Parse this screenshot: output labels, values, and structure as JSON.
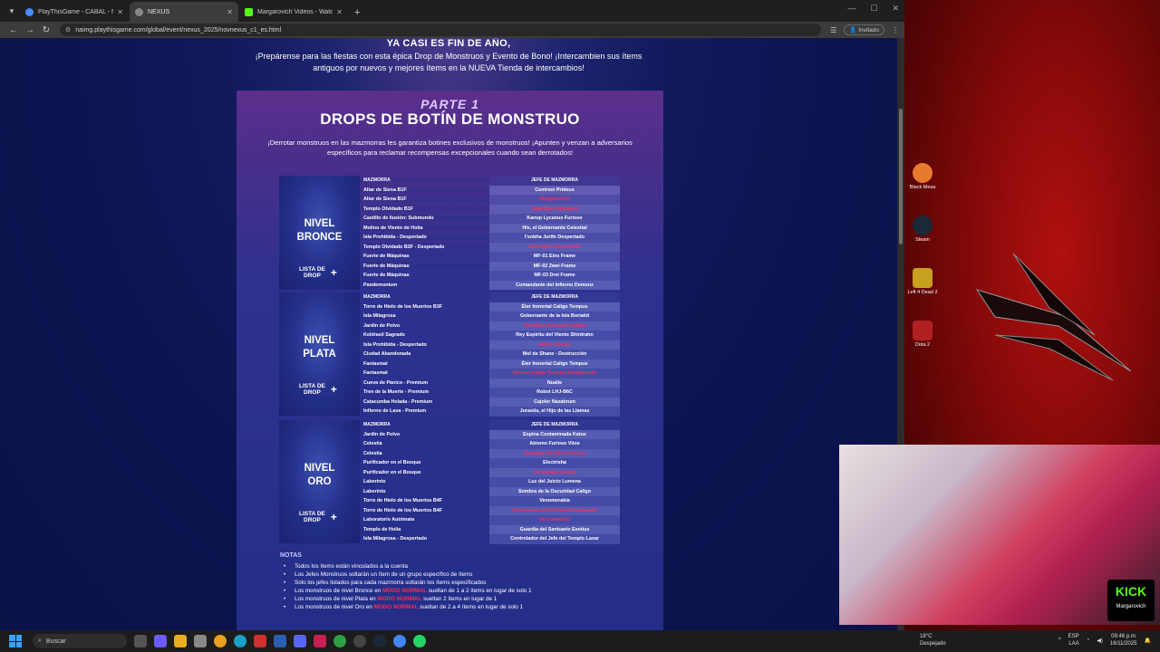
{
  "browser": {
    "tabs": [
      {
        "label": "PlayThisGame - CABAL - Notice",
        "active": false,
        "color": "#4a8cff"
      },
      {
        "label": "NEXUS",
        "active": true,
        "color": "#888888"
      },
      {
        "label": "Margarovich Videos - Watch C",
        "active": false,
        "color": "#53fc18"
      }
    ],
    "url": "naimg.playthisgame.com/global/event/nexus_2025/novnexus_c1_es.html",
    "guest_label": "Invitado"
  },
  "page": {
    "intro_title": "YA CASI ES FIN DE AÑO,",
    "intro_text": "¡Prepárense para las fiestas con esta épica Drop de Monstruos y Evento de Bono! ¡Intercambien sus ítems antiguos por nuevos y mejores ítems en la NUEVA Tienda de intercambios!",
    "part_label": "PARTE 1",
    "section_title": "DROPS DE BOTÍN DE MONSTRUO",
    "section_desc": "¡Derrotar monstruos en las mazmorras les garantiza botines exclusivos de monstruos! ¡Apunten y venzan a adversarios específicos para reclamar recompensas excepcionales cuando sean derrotados!",
    "col_dungeon": "MAZMORRA",
    "col_boss": "JEFE DE MAZMORRA",
    "drop_label_1": "LISTA DE",
    "drop_label_2": "DROP",
    "tiers": [
      {
        "name_1": "NIVEL",
        "name_2": "BRONCE",
        "rows": [
          {
            "dungeon": "Altar de Siena B1F",
            "boss": "Centrion Prideus",
            "hidden": false
          },
          {
            "dungeon": "Altar de Siena B1F",
            "boss": "Margarovich",
            "hidden": true
          },
          {
            "dungeon": "Templo Olvidado B1F",
            "boss": "Guardián Flamígero",
            "hidden": true
          },
          {
            "dungeon": "Castillo de Ilusión: Submundo",
            "boss": "Kanop Lycanus Furioso",
            "hidden": false
          },
          {
            "dungeon": "Molino de Viento de Holia",
            "boss": "Hix, el Gobernante Celestial",
            "hidden": false
          },
          {
            "dungeon": "Isla Prohibida - Despertado",
            "boss": "I'sobha Jurife Despertado",
            "hidden": false
          },
          {
            "dungeon": "Templo Olvidado B2F - Despertado",
            "boss": "Gran Ignis Despertado",
            "hidden": true
          },
          {
            "dungeon": "Fuerte de Máquinas",
            "boss": "MF-01 Eins Frame",
            "hidden": false
          },
          {
            "dungeon": "Fuerte de Máquinas",
            "boss": "MF-02 Zwei Frame",
            "hidden": false
          },
          {
            "dungeon": "Fuerte de Máquinas",
            "boss": "MF-03 Drei Frame",
            "hidden": false
          },
          {
            "dungeon": "Pandemonium",
            "boss": "Comandante del Infierno Demonz",
            "hidden": false
          }
        ]
      },
      {
        "name_1": "NIVEL",
        "name_2": "PLATA",
        "rows": [
          {
            "dungeon": "Torre de Hielo de los Muertos B3F",
            "boss": "Éter Inmortal Caligo Tempus",
            "hidden": false
          },
          {
            "dungeon": "Isla Milagrosa",
            "boss": "Gobernante de la Isla Borialid",
            "hidden": false
          },
          {
            "dungeon": "Jardín de Polvo",
            "boss": "Tormenta Ancestral Sablas",
            "hidden": true
          },
          {
            "dungeon": "Keldrasil Sagrado",
            "boss": "Rey Espíritu del Viento Shirdrahn",
            "hidden": false
          },
          {
            "dungeon": "Isla Prohibida - Despertado",
            "boss": "Señor Oscuro",
            "hidden": true
          },
          {
            "dungeon": "Ciudad Abandonada",
            "boss": "Mol de Shane - Destrucción",
            "hidden": false
          },
          {
            "dungeon": "Fantasmal",
            "boss": "Éter Inmortal Caligo Tempus",
            "hidden": false
          },
          {
            "dungeon": "Fantasmal",
            "boss": "Demon Caligo Tempus Encadenado",
            "hidden": true
          },
          {
            "dungeon": "Cueva de Pánico - Premium",
            "boss": "Nualle",
            "hidden": false
          },
          {
            "dungeon": "Tren de la Muerte - Premium",
            "boss": "Robot LHJ-B6C",
            "hidden": false
          },
          {
            "dungeon": "Catacumba Helada - Premium",
            "boss": "Cajoler Nazabrum",
            "hidden": false
          },
          {
            "dungeon": "Infierno de Lava - Premium",
            "boss": "Jurastia, el Hijo de las Llamas",
            "hidden": false
          }
        ]
      },
      {
        "name_1": "NIVEL",
        "name_2": "ORO",
        "rows": [
          {
            "dungeon": "Jardín de Polvo",
            "boss": "Espina Contaminada Katus",
            "hidden": false
          },
          {
            "dungeon": "Celestia",
            "boss": "Abismo Furioso Vitos",
            "hidden": false
          },
          {
            "dungeon": "Celestia",
            "boss": "Guardián del Vacío Oscuro",
            "hidden": true
          },
          {
            "dungeon": "Purificador en el Bosque",
            "boss": "Electrisha",
            "hidden": false
          },
          {
            "dungeon": "Purificador en el Bosque",
            "boss": "Ira Salvaje Oscura",
            "hidden": true
          },
          {
            "dungeon": "Laberinto",
            "boss": "Luz del Juicio Lumena",
            "hidden": false
          },
          {
            "dungeon": "Laberinto",
            "boss": "Sombra de la Oscuridad Caligo",
            "hidden": false
          },
          {
            "dungeon": "Torre de Hielo de los Muertos B4F",
            "boss": "Venomorakia",
            "hidden": false
          },
          {
            "dungeon": "Torre de Hielo de los Muertos B4F",
            "boss": "Gobernante del Abismo Encadenado",
            "hidden": true
          },
          {
            "dungeon": "Laboratorio Autómata",
            "boss": "Desconocido",
            "hidden": true
          },
          {
            "dungeon": "Templo de Holia",
            "boss": "Guardia del Santuario Exetius",
            "hidden": false
          },
          {
            "dungeon": "Isla Milagrosa - Despertado",
            "boss": "Controlador del Jefe del Templo Laxar",
            "hidden": false
          }
        ]
      }
    ],
    "notes_title": "NOTAS",
    "notes": [
      {
        "pre": "Todos los ítems están vinculados a la cuenta",
        "hl": "",
        "post": ""
      },
      {
        "pre": "Los Jefes Monstruos soltarán un ítem de un grupo específico de ítems",
        "hl": "",
        "post": ""
      },
      {
        "pre": "Solo los jefes listados para cada mazmorra soltarán los ítems especificados",
        "hl": "",
        "post": ""
      },
      {
        "pre": "Los monstruos de nivel Bronce en ",
        "hl": "MODO NORMAL",
        "post": " sueltan de 1 a 2 ítems en lugar de solo 1"
      },
      {
        "pre": "Los monstruos de nivel Plata en ",
        "hl": "MODO NORMAL",
        "post": " sueltan 2 ítems en lugar de 1"
      },
      {
        "pre": "Los monstruos de nivel Oro en ",
        "hl": "MODO NORMAL",
        "post": " sueltan de 2 a 4 ítems en lugar de solo 1"
      }
    ]
  },
  "desktop": {
    "icons": [
      {
        "label": "Black Mesa",
        "color": "#e87a30"
      },
      {
        "label": "Steam",
        "color": "#1b2838"
      },
      {
        "label": "Left 4 Dead 2",
        "color": "#c8a020"
      },
      {
        "label": "Dota 2",
        "color": "#b02020"
      }
    ]
  },
  "stream": {
    "brand": "KICK",
    "channel": "Margarovich"
  },
  "taskbar": {
    "search_placeholder": "Buscar",
    "weather_temp": "18°C",
    "weather_desc": "Despejado",
    "lang_1": "ESP",
    "lang_2": "LAA",
    "time": "09:46 p.m.",
    "date": "16/11/2025"
  }
}
